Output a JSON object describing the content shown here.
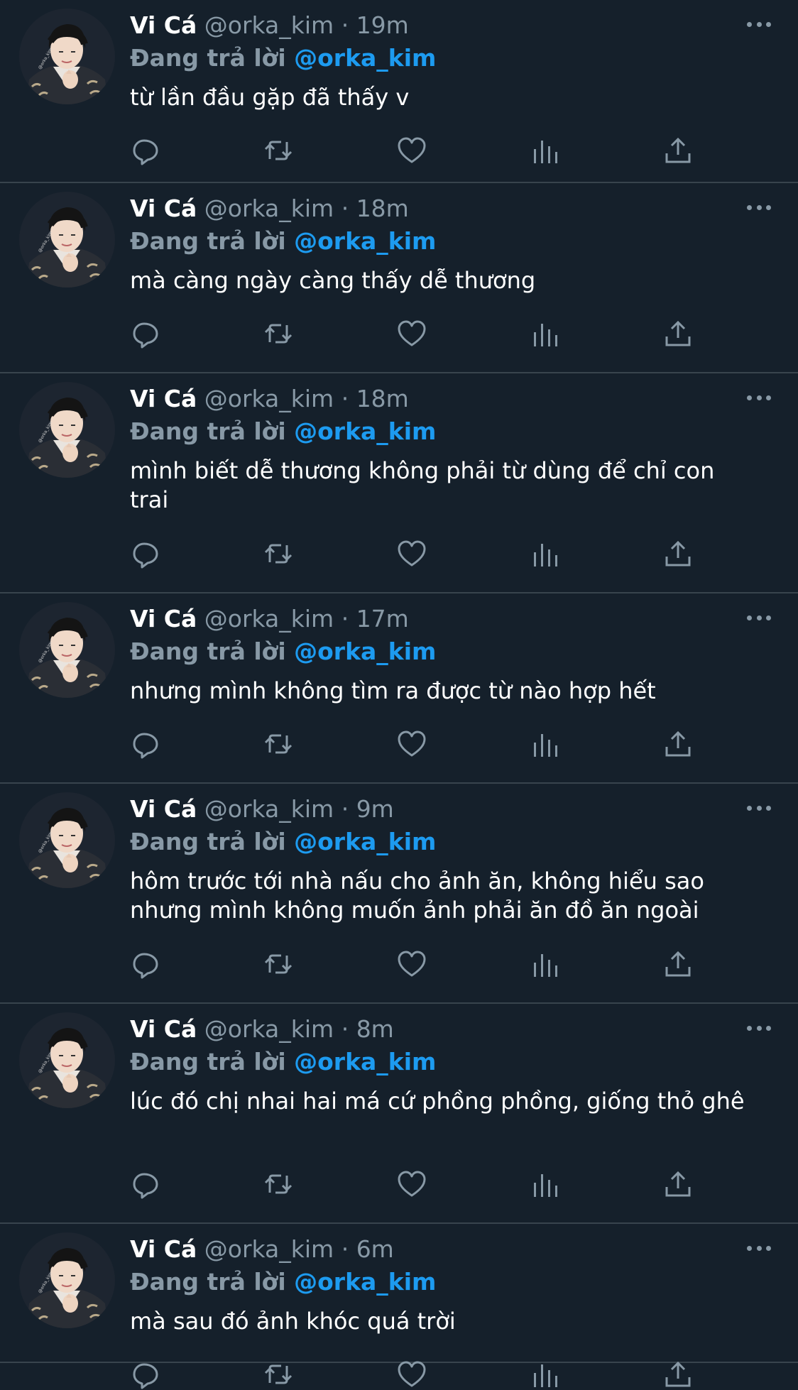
{
  "tweets": [
    {
      "name": "Vi Cá",
      "handle": "@orka_kim",
      "separator": "·",
      "time": "19m",
      "reply_prefix": "Đang trả lời",
      "reply_to": "@orka_kim",
      "text": "từ lần đầu gặp đã thấy v"
    },
    {
      "name": "Vi Cá",
      "handle": "@orka_kim",
      "separator": "·",
      "time": "18m",
      "reply_prefix": "Đang trả lời",
      "reply_to": "@orka_kim",
      "text": "mà càng ngày càng thấy dễ thương"
    },
    {
      "name": "Vi Cá",
      "handle": "@orka_kim",
      "separator": "·",
      "time": "18m",
      "reply_prefix": "Đang trả lời",
      "reply_to": "@orka_kim",
      "text": "mình biết dễ thương không phải từ dùng để chỉ con trai"
    },
    {
      "name": "Vi Cá",
      "handle": "@orka_kim",
      "separator": "·",
      "time": "17m",
      "reply_prefix": "Đang trả lời",
      "reply_to": "@orka_kim",
      "text": "nhưng mình không tìm ra được từ nào hợp hết"
    },
    {
      "name": "Vi Cá",
      "handle": "@orka_kim",
      "separator": "·",
      "time": "9m",
      "reply_prefix": "Đang trả lời",
      "reply_to": "@orka_kim",
      "text": "hôm trước tới nhà nấu cho ảnh ăn, không hiểu sao nhưng mình không muốn ảnh phải ăn đồ ăn ngoài"
    },
    {
      "name": "Vi Cá",
      "handle": "@orka_kim",
      "separator": "·",
      "time": "8m",
      "reply_prefix": "Đang trả lời",
      "reply_to": "@orka_kim",
      "text": "lúc đó chị nhai hai má cứ phồng phồng, giống thỏ ghê"
    },
    {
      "name": "Vi Cá",
      "handle": "@orka_kim",
      "separator": "·",
      "time": "6m",
      "reply_prefix": "Đang trả lời",
      "reply_to": "@orka_kim",
      "text": "mà sau đó ảnh khóc quá trời"
    }
  ],
  "icons": {
    "reply": "reply-icon",
    "retweet": "retweet-icon",
    "like": "heart-icon",
    "analytics": "analytics-icon",
    "share": "share-icon",
    "more": "more-icon"
  },
  "colors": {
    "background": "#15202b",
    "divider": "#38444d",
    "secondary_text": "#8899a6",
    "mention": "#1d9bf0",
    "primary_text": "#ffffff"
  }
}
